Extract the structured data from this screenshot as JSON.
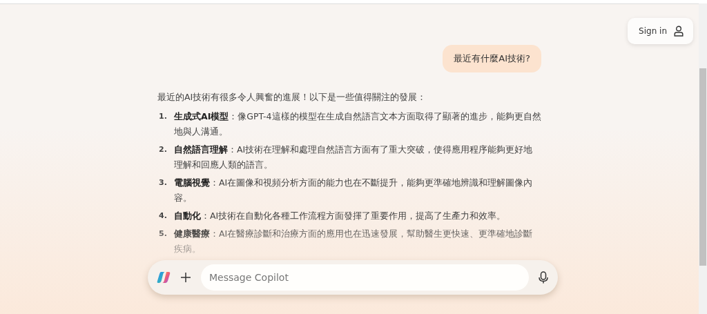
{
  "header": {
    "sign_in_button": "Sign in"
  },
  "user_message": "最近有什麼AI技術?",
  "reply": {
    "intro": "最近的AI技術有很多令人興奮的進展！以下是一些值得關注的發展：",
    "items": [
      {
        "number": "1.",
        "text": "**生成式AI模型**：像GPT-4這樣的模型在生成自然語言文本方面取得了顯著的進步，能夠更自然地與人溝通。"
      },
      {
        "number": "2.",
        "text": "**自然語言理解**：AI技術在理解和處理自然語言方面有了重大突破，使得應用程序能夠更好地理解和回應人類的語言。"
      },
      {
        "number": "3.",
        "text": "**電腦視覺**：AI在圖像和視頻分析方面的能力也在不斷提升，能夠更準確地辨識和理解圖像內容。"
      },
      {
        "number": "4.",
        "text": "**自動化**：AI技術在自動化各種工作流程方面發揮了重要作用，提高了生產力和效率。"
      },
      {
        "number": "5.",
        "text": "**健康醫療**：AI在醫療診斷和治療方面的應用也在迅速發展，幫助醫生更快速、更準確地診斷疾病。"
      }
    ]
  },
  "composer": {
    "placeholder": "Message Copilot"
  }
}
